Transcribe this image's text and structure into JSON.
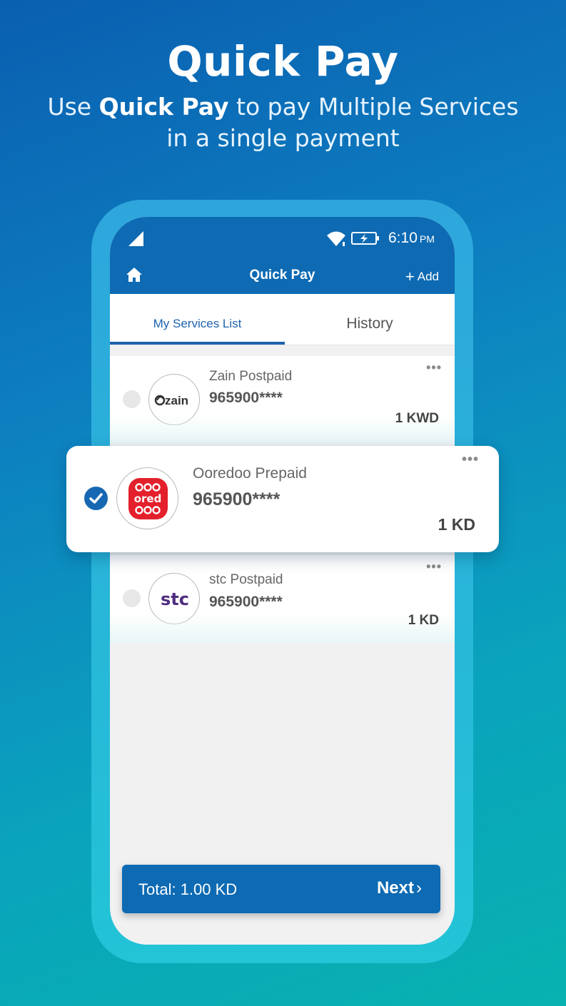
{
  "headline": {
    "title": "Quick Pay",
    "subtitle_pre": "Use ",
    "subtitle_bold": "Quick Pay",
    "subtitle_post": " to pay Multiple Services",
    "subtitle_line2": "in a single payment"
  },
  "status_bar": {
    "time": "6:10",
    "ampm": "PM",
    "icons": [
      "signal-icon",
      "wifi-icon",
      "battery-charging-icon"
    ]
  },
  "app_bar": {
    "home_icon": "home-icon",
    "title": "Quick Pay",
    "add_plus": "+",
    "add_label": "Add"
  },
  "tabs": [
    {
      "label": "My Services List",
      "active": true
    },
    {
      "label": "History",
      "active": false
    }
  ],
  "services": [
    {
      "name": "Zain Postpaid",
      "number": "965900****",
      "amount": "1 KWD",
      "selected": false,
      "logo_text": "zain",
      "menu": "•••"
    },
    {
      "name": "Ooredoo Prepaid",
      "number": "965900****",
      "amount": "1 KD",
      "selected": true,
      "logo_text": "ored",
      "menu": "•••"
    },
    {
      "name": "stc Postpaid",
      "number": "965900****",
      "amount": "1 KD",
      "selected": false,
      "logo_text": "stc",
      "menu": "•••"
    }
  ],
  "footer": {
    "total": "Total: 1.00 KD",
    "next_label": "Next",
    "next_chevron": "›"
  },
  "colors": {
    "primary": "#0d6ab3",
    "tab_active": "#1e63ad",
    "ooredoo_red": "#e3202b",
    "stc_purple": "#4f2d7f"
  }
}
